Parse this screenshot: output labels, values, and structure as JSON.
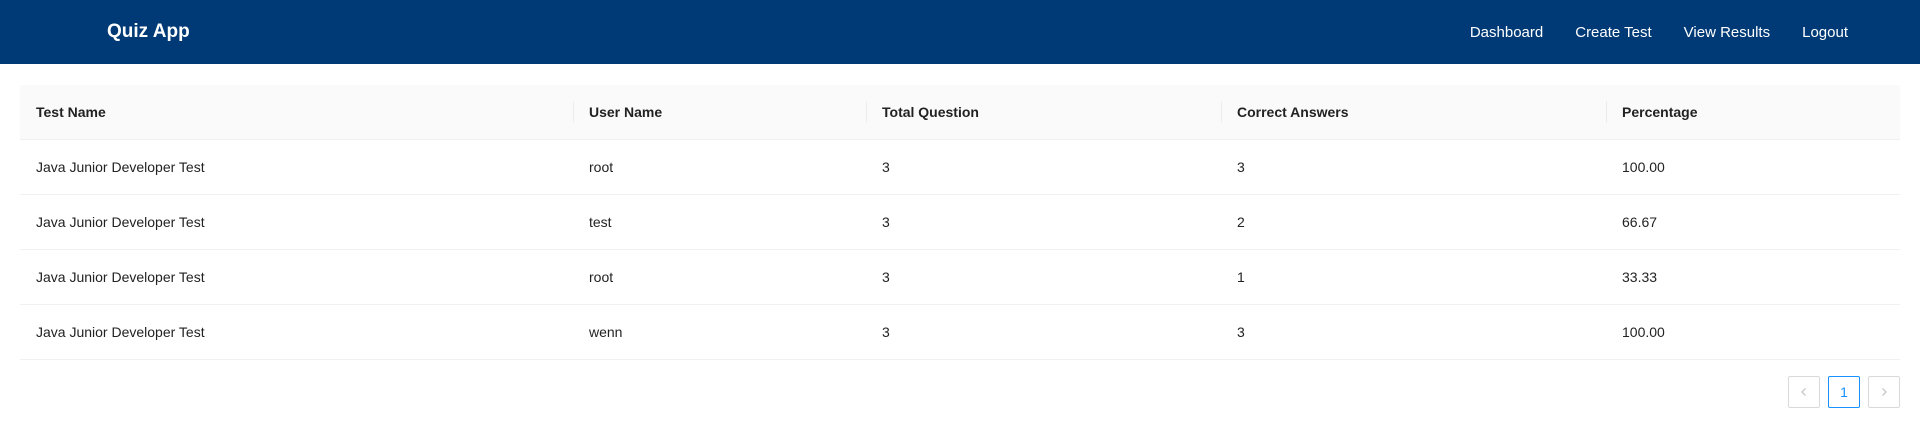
{
  "navbar": {
    "brand": "Quiz App",
    "links": [
      "Dashboard",
      "Create Test",
      "View Results",
      "Logout"
    ]
  },
  "table": {
    "headers": [
      "Test Name",
      "User Name",
      "Total Question",
      "Correct Answers",
      "Percentage"
    ],
    "rows": [
      [
        "Java Junior Developer Test",
        "root",
        "3",
        "3",
        "100.00"
      ],
      [
        "Java Junior Developer Test",
        "test",
        "3",
        "2",
        "66.67"
      ],
      [
        "Java Junior Developer Test",
        "root",
        "3",
        "1",
        "33.33"
      ],
      [
        "Java Junior Developer Test",
        "wenn",
        "3",
        "3",
        "100.00"
      ]
    ]
  },
  "pagination": {
    "current_page": "1",
    "prev_icon": "chevron-left-icon",
    "next_icon": "chevron-right-icon",
    "active_color": "#1890ff"
  },
  "colors": {
    "navbar": "#003a76",
    "header_bg": "#fafafa"
  }
}
